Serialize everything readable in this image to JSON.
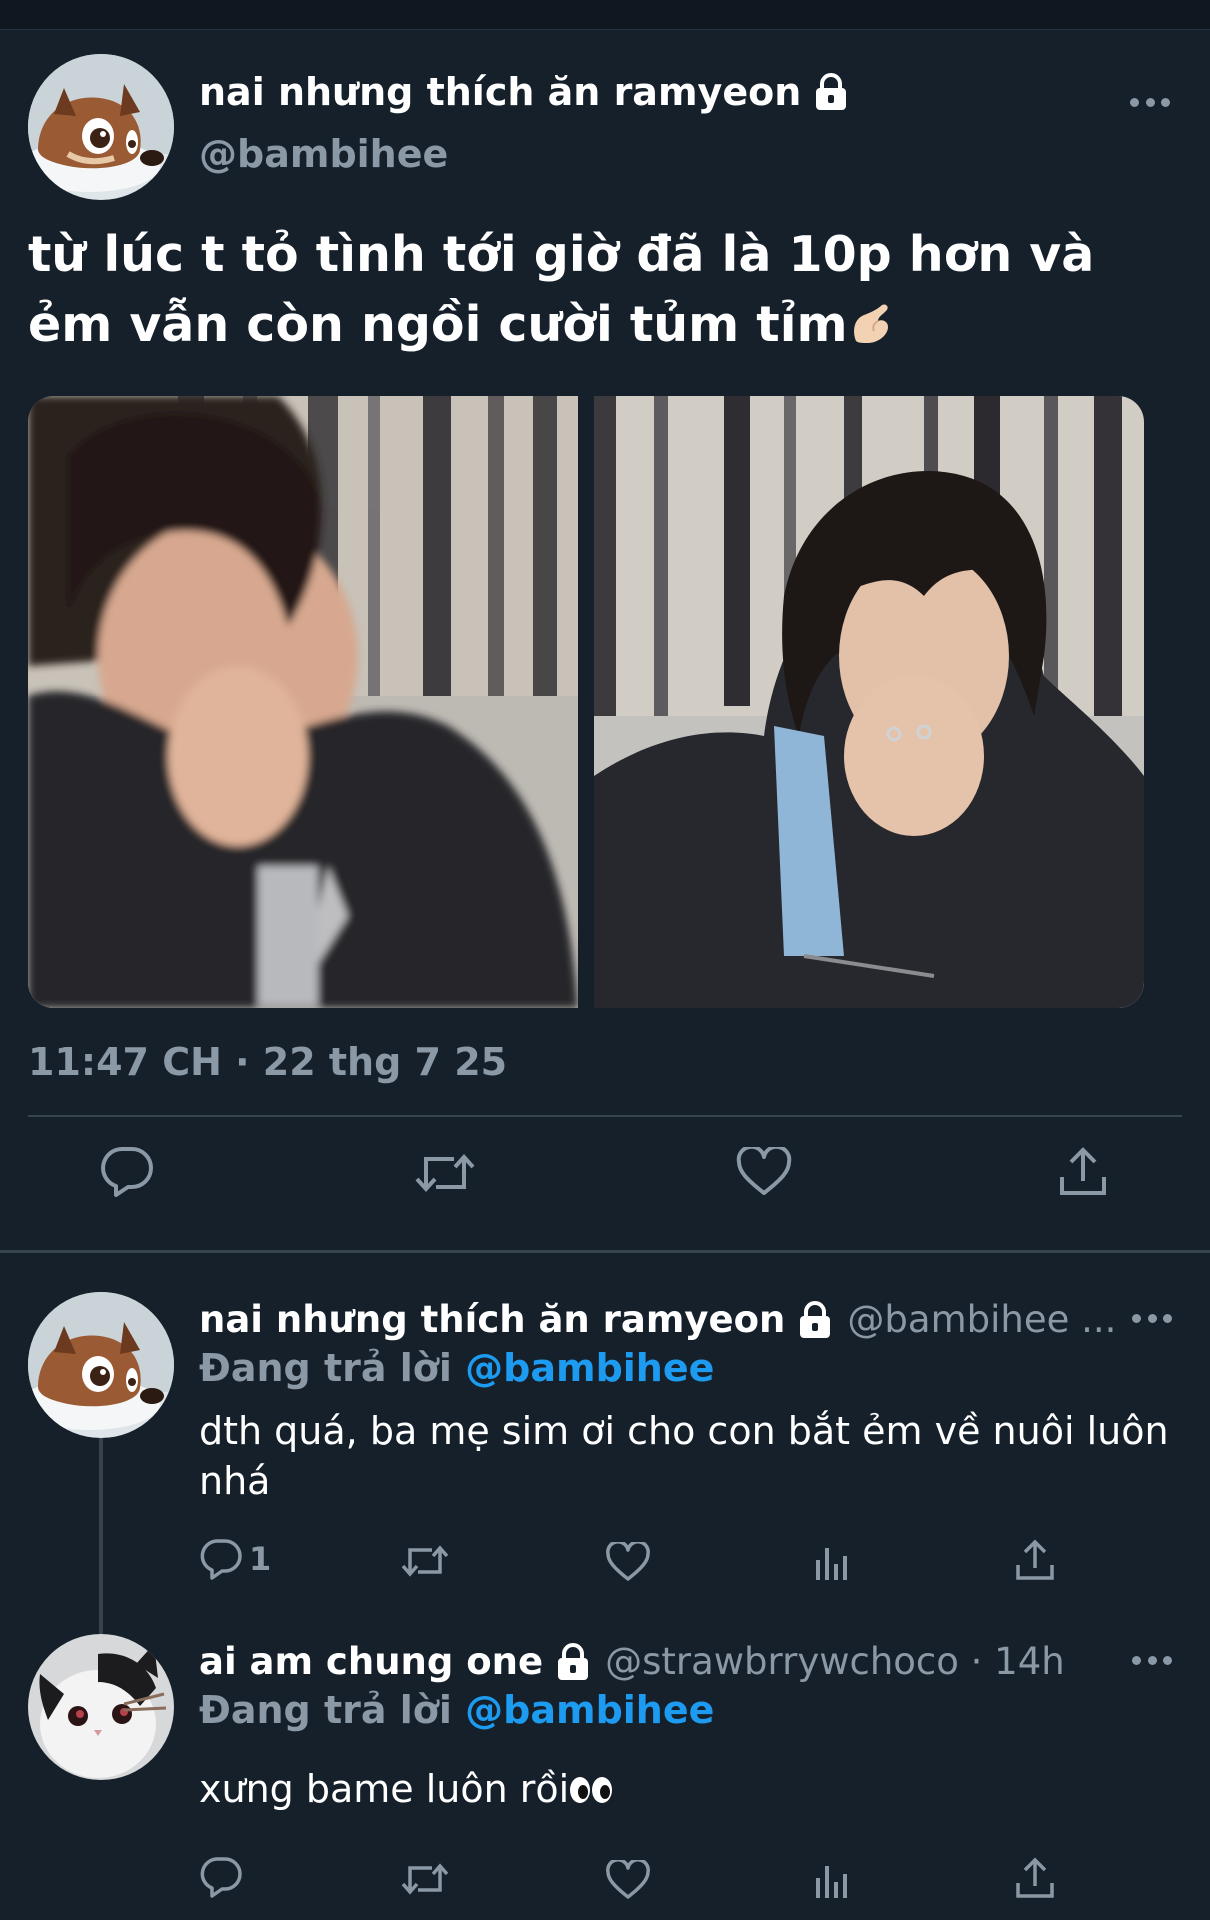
{
  "main_tweet": {
    "display_name": "nai nhưng thích ăn ramyeon",
    "handle": "@bambihee",
    "text": "từ lúc t tỏ tình tới giờ đã là 10p hơn và ẻm vẫn còn ngồi cười tủm tỉm",
    "timestamp": "11:47 CH · 22 thg 7 25",
    "icons": [
      "reply-icon",
      "retweet-icon",
      "like-icon",
      "share-icon"
    ]
  },
  "replies": [
    {
      "display_name": "nai nhưng thích ăn ramyeon",
      "handle": "@bambihee ...",
      "replying_prefix": "Đang trả lời",
      "replying_to": "@bambihee",
      "text": "dth quá, ba mẹ sim ơi cho con bắt ẻm về nuôi luôn nhá",
      "reply_count": "1"
    },
    {
      "display_name": "ai am chung one",
      "handle": "@strawbrrywchoco · 14h",
      "replying_prefix": "Đang trả lời",
      "replying_to": "@bambihee",
      "text": "xưng bame luôn rồi"
    }
  ],
  "colors": {
    "background": "#15202b",
    "secondary_text": "#8b98a5",
    "link": "#1d9bf0",
    "divider": "#38444d"
  }
}
